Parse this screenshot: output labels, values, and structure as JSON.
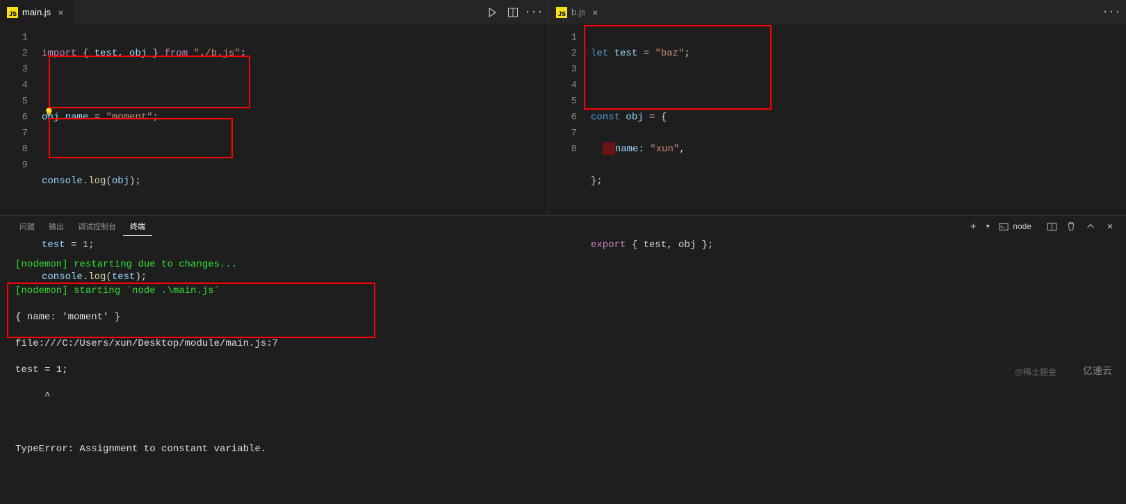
{
  "left_editor": {
    "filename": "main.js",
    "lines": [
      1,
      2,
      3,
      4,
      5,
      6,
      7,
      8,
      9
    ],
    "code": {
      "l1_import": "import",
      "l1_from": "from",
      "l1_brace_open": "{ ",
      "l1_ids": "test, obj",
      "l1_brace_close": " }",
      "l1_path": "\"./b.js\"",
      "l1_semi": ";",
      "l3_obj": "obj",
      "l3_name": ".name",
      "l3_eq": " = ",
      "l3_val": "\"moment\"",
      "l3_semi": ";",
      "l5_console": "console",
      "l5_log": ".log",
      "l5_arg": "obj",
      "l7_test": "test",
      "l7_eq": " = ",
      "l7_val": "1",
      "l7_semi": ";",
      "l8_console": "console",
      "l8_log": ".log",
      "l8_arg": "test"
    }
  },
  "right_editor": {
    "filename": "b.js",
    "lines": [
      1,
      2,
      3,
      4,
      5,
      6,
      7,
      8
    ],
    "code": {
      "l1_let": "let",
      "l1_test": "test",
      "l1_eq": " = ",
      "l1_val": "\"baz\"",
      "l1_semi": ";",
      "l3_const": "const",
      "l3_obj": "obj",
      "l3_eq": " = {",
      "l4_name": "name",
      "l4_colon": ": ",
      "l4_val": "\"xun\"",
      "l4_comma": ",",
      "l5_close": "};",
      "l7_export": "export",
      "l7_ids": "{ test, obj }",
      "l7_semi": ";"
    }
  },
  "panel": {
    "tabs": {
      "problems": "问题",
      "output": "输出",
      "debug": "调试控制台",
      "terminal": "终端"
    },
    "shell_label": "node"
  },
  "terminal": {
    "line1_prefix": "[nodemon]",
    "line1_text": " restarting due to changes...",
    "line2_prefix": "[nodemon]",
    "line2_text": " starting `node .\\main.js`",
    "line3": "{ name: 'moment' }",
    "line4": "file:///C:/Users/xun/Desktop/module/main.js:7",
    "line5": "test = 1;",
    "line6": "     ^",
    "line7": "TypeError: Assignment to constant variable."
  },
  "watermarks": {
    "w1": "@稀土掘金",
    "w2": "亿速云"
  }
}
